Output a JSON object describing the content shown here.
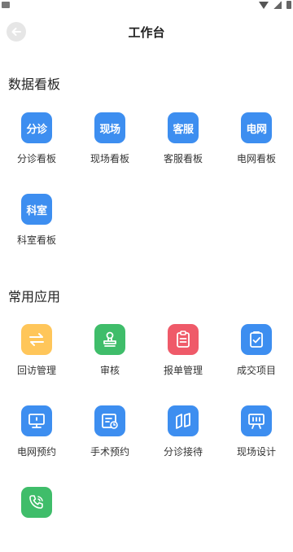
{
  "header": {
    "title": "工作台"
  },
  "colors": {
    "blue": "#3d8ef0",
    "yellow": "#ffc65a",
    "green": "#3fbd6a",
    "red": "#ef5a69"
  },
  "dashboards": {
    "title": "数据看板",
    "items": [
      {
        "icon_text": "分诊",
        "label": "分诊看板"
      },
      {
        "icon_text": "现场",
        "label": "现场看板"
      },
      {
        "icon_text": "客服",
        "label": "客服看板"
      },
      {
        "icon_text": "电网",
        "label": "电网看板"
      },
      {
        "icon_text": "科室",
        "label": "科室看板"
      }
    ]
  },
  "apps": {
    "title": "常用应用",
    "items": [
      {
        "icon": "exchange-icon",
        "label": "回访管理"
      },
      {
        "icon": "stamp-icon",
        "label": "审核"
      },
      {
        "icon": "clipboard-icon",
        "label": "报单管理"
      },
      {
        "icon": "check-document-icon",
        "label": "成交项目"
      },
      {
        "icon": "monitor-icon",
        "label": "电网预约"
      },
      {
        "icon": "schedule-icon",
        "label": "手术预约"
      },
      {
        "icon": "map-fold-icon",
        "label": "分诊接待"
      },
      {
        "icon": "presentation-icon",
        "label": "现场设计"
      },
      {
        "icon": "phone-icon",
        "label": ""
      }
    ]
  }
}
